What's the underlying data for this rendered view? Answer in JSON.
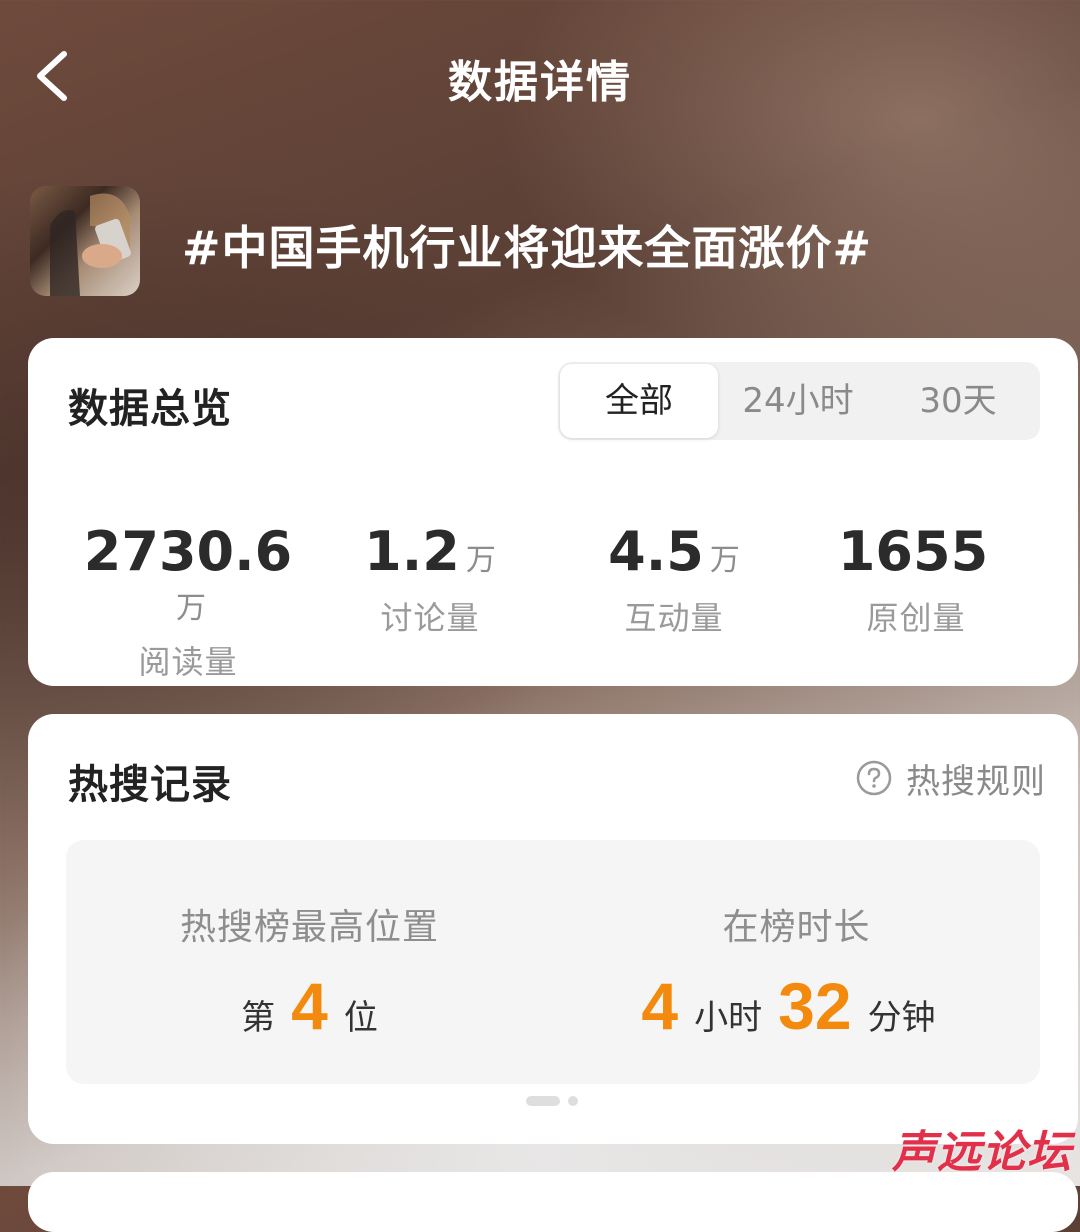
{
  "header": {
    "title": "数据详情"
  },
  "topic": {
    "title": "#中国手机行业将迎来全面涨价#"
  },
  "overview": {
    "title": "数据总览",
    "tabs": [
      {
        "label": "全部",
        "active": true
      },
      {
        "label": "24小时",
        "active": false
      },
      {
        "label": "30天",
        "active": false
      }
    ],
    "stats": [
      {
        "value": "2730.6",
        "unit": "万",
        "label": "阅读量"
      },
      {
        "value": "1.2",
        "unit": "万",
        "label": "讨论量"
      },
      {
        "value": "4.5",
        "unit": "万",
        "label": "互动量"
      },
      {
        "value": "1655",
        "unit": "",
        "label": "原创量"
      }
    ]
  },
  "hot_search": {
    "title": "热搜记录",
    "rule_label": "热搜规则",
    "highest": {
      "label": "热搜榜最高位置",
      "prefix": "第",
      "value": "4",
      "suffix": "位"
    },
    "duration": {
      "label": "在榜时长",
      "hours": "4",
      "hours_unit": "小时",
      "minutes": "32",
      "minutes_unit": "分钟"
    }
  },
  "watermark": "声远论坛",
  "colors": {
    "accent": "#f38a0e",
    "watermark": "#e3304a"
  }
}
